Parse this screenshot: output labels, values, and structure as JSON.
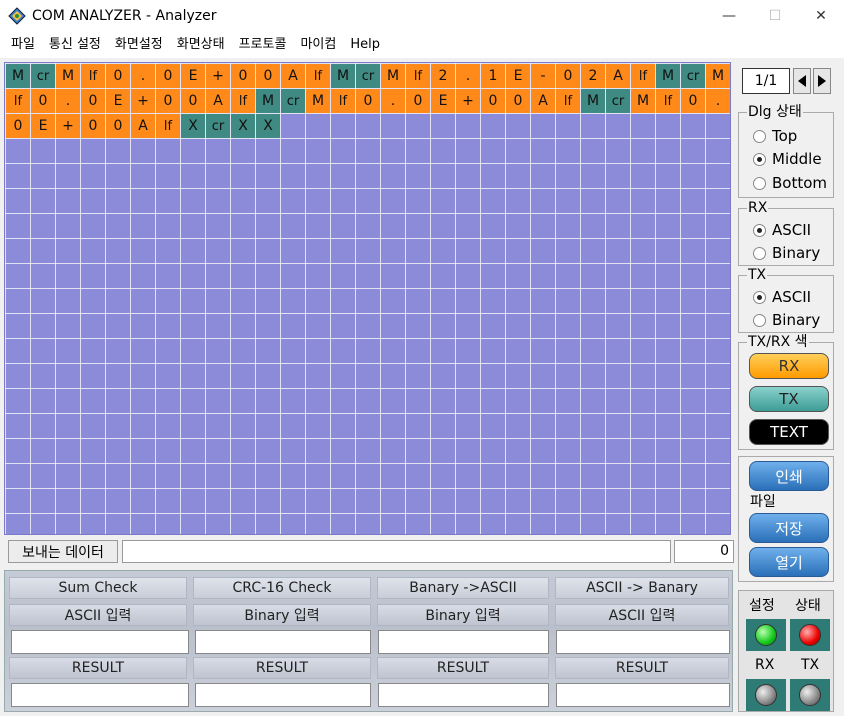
{
  "window": {
    "title": "COM ANALYZER - Analyzer",
    "controls": [
      "—",
      "☐",
      "✕"
    ]
  },
  "menu": [
    "파일",
    "통신 설정",
    "화면설정",
    "화면상태",
    "프로토콜",
    "마이컴",
    "Help"
  ],
  "grid": {
    "rows": [
      [
        [
          "M",
          "ctl"
        ],
        [
          "cr",
          "ctl"
        ],
        [
          "M",
          "rx"
        ],
        [
          "lf",
          "rx"
        ],
        [
          "0",
          "rx"
        ],
        [
          ".",
          "rx"
        ],
        [
          "0",
          "rx"
        ],
        [
          "E",
          "rx"
        ],
        [
          "+",
          "rx"
        ],
        [
          "0",
          "rx"
        ],
        [
          "0",
          "rx"
        ],
        [
          "A",
          "rx"
        ],
        [
          "lf",
          "rx"
        ],
        [
          "M",
          "ctl"
        ],
        [
          "cr",
          "ctl"
        ],
        [
          "M",
          "rx"
        ],
        [
          "lf",
          "rx"
        ],
        [
          "2",
          "rx"
        ],
        [
          ".",
          "rx"
        ],
        [
          "1",
          "rx"
        ],
        [
          "E",
          "rx"
        ],
        [
          "-",
          "rx"
        ],
        [
          "0",
          "rx"
        ],
        [
          "2",
          "rx"
        ],
        [
          "A",
          "rx"
        ],
        [
          "lf",
          "rx"
        ],
        [
          "M",
          "ctl"
        ],
        [
          "cr",
          "ctl"
        ],
        [
          "M",
          "rx"
        ]
      ],
      [
        [
          "lf",
          "rx"
        ],
        [
          "0",
          "rx"
        ],
        [
          ".",
          "rx"
        ],
        [
          "0",
          "rx"
        ],
        [
          "E",
          "rx"
        ],
        [
          "+",
          "rx"
        ],
        [
          "0",
          "rx"
        ],
        [
          "0",
          "rx"
        ],
        [
          "A",
          "rx"
        ],
        [
          "lf",
          "rx"
        ],
        [
          "M",
          "ctl"
        ],
        [
          "cr",
          "ctl"
        ],
        [
          "M",
          "rx"
        ],
        [
          "lf",
          "rx"
        ],
        [
          "0",
          "rx"
        ],
        [
          ".",
          "rx"
        ],
        [
          "0",
          "rx"
        ],
        [
          "E",
          "rx"
        ],
        [
          "+",
          "rx"
        ],
        [
          "0",
          "rx"
        ],
        [
          "0",
          "rx"
        ],
        [
          "A",
          "rx"
        ],
        [
          "lf",
          "rx"
        ],
        [
          "M",
          "ctl"
        ],
        [
          "cr",
          "ctl"
        ],
        [
          "M",
          "rx"
        ],
        [
          "lf",
          "rx"
        ],
        [
          "0",
          "rx"
        ],
        [
          ".",
          "rx"
        ]
      ],
      [
        [
          "0",
          "rx"
        ],
        [
          "E",
          "rx"
        ],
        [
          "+",
          "rx"
        ],
        [
          "0",
          "rx"
        ],
        [
          "0",
          "rx"
        ],
        [
          "A",
          "rx"
        ],
        [
          "lf",
          "rx"
        ],
        [
          "X",
          "ctl"
        ],
        [
          "cr",
          "ctl"
        ],
        [
          "X",
          "ctl"
        ],
        [
          "X",
          "ctl"
        ]
      ]
    ]
  },
  "send": {
    "label": "보내는 데이터",
    "value": "",
    "count": "0"
  },
  "tools": [
    {
      "title": "Sum Check",
      "input_label": "ASCII 입력",
      "result_label": "RESULT"
    },
    {
      "title": "CRC-16 Check",
      "input_label": "Binary 입력",
      "result_label": "RESULT"
    },
    {
      "title": "Banary ->ASCII",
      "input_label": "Binary 입력",
      "result_label": "RESULT"
    },
    {
      "title": "ASCII -> Banary",
      "input_label": "ASCII 입력",
      "result_label": "RESULT"
    }
  ],
  "right": {
    "page": "1/1",
    "dlg": {
      "label": "Dlg 상태",
      "options": [
        "Top",
        "Middle",
        "Bottom"
      ],
      "selected": "Middle"
    },
    "rx": {
      "label": "RX",
      "options": [
        "ASCII",
        "Binary"
      ],
      "selected": "ASCII"
    },
    "tx": {
      "label": "TX",
      "options": [
        "ASCII",
        "Binary"
      ],
      "selected": "ASCII"
    },
    "color": {
      "label": "TX/RX 색",
      "rx": "RX",
      "tx": "TX",
      "text": "TEXT"
    },
    "print": "인쇄",
    "file": {
      "label": "파일",
      "save": "저장",
      "open": "열기"
    },
    "status": {
      "setting": "설정",
      "state": "상태",
      "rx": "RX",
      "tx": "TX"
    },
    "colors": {
      "rx_cell": "#ff8a1a",
      "ctl_cell": "#3f8a82",
      "grid_bg": "#8b8bd9"
    }
  }
}
